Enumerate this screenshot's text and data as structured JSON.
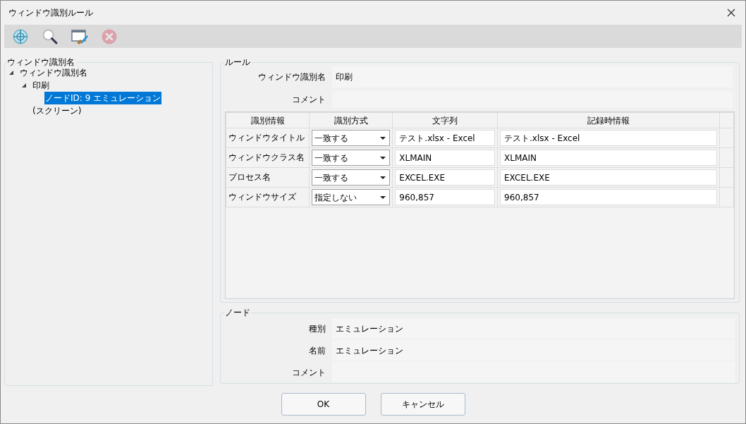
{
  "window": {
    "title": "ウィンドウ識別ルール"
  },
  "toolbar": [
    {
      "kind": "target",
      "disabled": false
    },
    {
      "kind": "search",
      "disabled": false
    },
    {
      "kind": "edit",
      "disabled": false
    },
    {
      "kind": "delete",
      "disabled": true
    }
  ],
  "tree": {
    "label": "ウィンドウ識別名",
    "items": [
      {
        "label": "ウィンドウ識別名",
        "selected": false,
        "expanded": true,
        "children": [
          {
            "label": "印刷",
            "selected": false,
            "expanded": true,
            "children": [
              {
                "label": "ノードID: 9 エミュレーション",
                "selected": true
              }
            ]
          },
          {
            "label": "(スクリーン)",
            "selected": false
          }
        ]
      }
    ]
  },
  "rule": {
    "label": "ルール",
    "fields": [
      {
        "label": "ウィンドウ識別名",
        "value": "印刷"
      },
      {
        "label": "コメント"
      }
    ],
    "table": {
      "columns": [
        "識別情報",
        "識別方式",
        "文字列",
        "記録時情報"
      ],
      "rows": [
        {
          "info": "ウィンドウタイトル",
          "method": "一致する",
          "string": "テスト.xlsx - Excel",
          "recorded": "テスト.xlsx - Excel"
        },
        {
          "info": "ウィンドウクラス名",
          "method": "一致する",
          "string": "XLMAIN",
          "recorded": "XLMAIN"
        },
        {
          "info": "プロセス名",
          "method": "一致する",
          "string": "EXCEL.EXE",
          "recorded": "EXCEL.EXE"
        },
        {
          "info": "ウィンドウサイズ",
          "method": "指定しない",
          "string": "960,857",
          "recorded": "960,857"
        }
      ]
    }
  },
  "node": {
    "label": "ノード",
    "fields": [
      {
        "label": "種別",
        "value": "エミュレーション"
      },
      {
        "label": "名前",
        "value": "エミュレーション"
      },
      {
        "label": "コメント"
      }
    ]
  },
  "buttons": [
    "OK",
    "キャンセル"
  ]
}
